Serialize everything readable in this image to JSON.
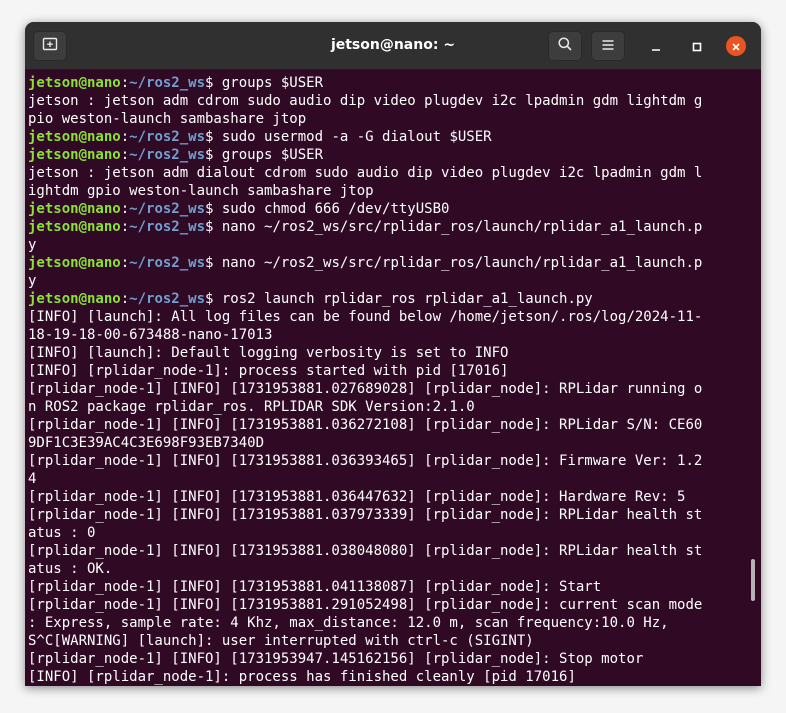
{
  "window": {
    "title": "jetson@nano: ~"
  },
  "colors": {
    "terminal_bg": "#300a24",
    "user_host": "#8ae234",
    "path": "#729fcf",
    "close_button": "#e95420"
  },
  "icons": {
    "new_tab": "new-tab-icon",
    "search": "search-icon",
    "menu": "hamburger-menu-icon",
    "minimize": "minimize-icon",
    "maximize": "maximize-icon",
    "close": "close-icon"
  },
  "terminal": {
    "lines": [
      {
        "type": "prompt",
        "user": "jetson@nano",
        "sep": ":",
        "path": "~/ros2_ws",
        "sym": "$ ",
        "cmd": "groups $USER"
      },
      {
        "type": "out",
        "text": "jetson : jetson adm cdrom sudo audio dip video plugdev i2c lpadmin gdm lightdm g"
      },
      {
        "type": "out",
        "text": "pio weston-launch sambashare jtop"
      },
      {
        "type": "prompt",
        "user": "jetson@nano",
        "sep": ":",
        "path": "~/ros2_ws",
        "sym": "$ ",
        "cmd": "sudo usermod -a -G dialout $USER"
      },
      {
        "type": "prompt",
        "user": "jetson@nano",
        "sep": ":",
        "path": "~/ros2_ws",
        "sym": "$ ",
        "cmd": "groups $USER"
      },
      {
        "type": "out",
        "text": "jetson : jetson adm dialout cdrom sudo audio dip video plugdev i2c lpadmin gdm l"
      },
      {
        "type": "out",
        "text": "ightdm gpio weston-launch sambashare jtop"
      },
      {
        "type": "prompt",
        "user": "jetson@nano",
        "sep": ":",
        "path": "~/ros2_ws",
        "sym": "$ ",
        "cmd": "sudo chmod 666 /dev/ttyUSB0"
      },
      {
        "type": "prompt",
        "user": "jetson@nano",
        "sep": ":",
        "path": "~/ros2_ws",
        "sym": "$ ",
        "cmd": "nano ~/ros2_ws/src/rplidar_ros/launch/rplidar_a1_launch.p"
      },
      {
        "type": "out",
        "text": "y"
      },
      {
        "type": "prompt",
        "user": "jetson@nano",
        "sep": ":",
        "path": "~/ros2_ws",
        "sym": "$ ",
        "cmd": "nano ~/ros2_ws/src/rplidar_ros/launch/rplidar_a1_launch.p"
      },
      {
        "type": "out",
        "text": "y"
      },
      {
        "type": "prompt",
        "user": "jetson@nano",
        "sep": ":",
        "path": "~/ros2_ws",
        "sym": "$ ",
        "cmd": "ros2 launch rplidar_ros rplidar_a1_launch.py"
      },
      {
        "type": "out",
        "text": "[INFO] [launch]: All log files can be found below /home/jetson/.ros/log/2024-11-"
      },
      {
        "type": "out",
        "text": "18-19-18-00-673488-nano-17013"
      },
      {
        "type": "out",
        "text": "[INFO] [launch]: Default logging verbosity is set to INFO"
      },
      {
        "type": "out",
        "text": "[INFO] [rplidar_node-1]: process started with pid [17016]"
      },
      {
        "type": "out",
        "text": "[rplidar_node-1] [INFO] [1731953881.027689028] [rplidar_node]: RPLidar running o"
      },
      {
        "type": "out",
        "text": "n ROS2 package rplidar_ros. RPLIDAR SDK Version:2.1.0"
      },
      {
        "type": "out",
        "text": "[rplidar_node-1] [INFO] [1731953881.036272108] [rplidar_node]: RPLidar S/N: CE60"
      },
      {
        "type": "out",
        "text": "9DF1C3E39AC4C3E698F93EB7340D"
      },
      {
        "type": "out",
        "text": "[rplidar_node-1] [INFO] [1731953881.036393465] [rplidar_node]: Firmware Ver: 1.2"
      },
      {
        "type": "out",
        "text": "4"
      },
      {
        "type": "out",
        "text": "[rplidar_node-1] [INFO] [1731953881.036447632] [rplidar_node]: Hardware Rev: 5"
      },
      {
        "type": "out",
        "text": "[rplidar_node-1] [INFO] [1731953881.037973339] [rplidar_node]: RPLidar health st"
      },
      {
        "type": "out",
        "text": "atus : 0"
      },
      {
        "type": "out",
        "text": "[rplidar_node-1] [INFO] [1731953881.038048080] [rplidar_node]: RPLidar health st"
      },
      {
        "type": "out",
        "text": "atus : OK."
      },
      {
        "type": "out",
        "text": "[rplidar_node-1] [INFO] [1731953881.041138087] [rplidar_node]: Start"
      },
      {
        "type": "out",
        "text": "[rplidar_node-1] [INFO] [1731953881.291052498] [rplidar_node]: current scan mode"
      },
      {
        "type": "out",
        "text": ": Express, sample rate: 4 Khz, max_distance: 12.0 m, scan frequency:10.0 Hz,"
      },
      {
        "type": "out",
        "text": "S^C[WARNING] [launch]: user interrupted with ctrl-c (SIGINT)"
      },
      {
        "type": "out",
        "text": "[rplidar_node-1] [INFO] [1731953947.145162156] [rplidar_node]: Stop motor"
      },
      {
        "type": "out",
        "text": "[INFO] [rplidar_node-1]: process has finished cleanly [pid 17016]"
      }
    ]
  }
}
